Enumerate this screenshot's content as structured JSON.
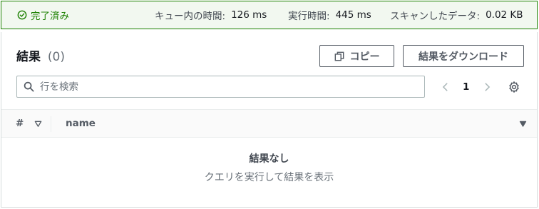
{
  "status": {
    "state_label": "完了済み",
    "queue_time_label": "キュー内の時間:",
    "queue_time_value": "126 ms",
    "run_time_label": "実行時間:",
    "run_time_value": "445 ms",
    "data_scanned_label": "スキャンしたデータ:",
    "data_scanned_value": "0.02 KB"
  },
  "results": {
    "title": "結果",
    "count": "(0)",
    "copy_label": "コピー",
    "download_label": "結果をダウンロード",
    "search_placeholder": "行を検索",
    "page_number": "1"
  },
  "table": {
    "columns": [
      "#",
      "name"
    ]
  },
  "empty": {
    "title": "結果なし",
    "subtitle": "クエリを実行して結果を表示"
  },
  "colors": {
    "success": "#1d8102",
    "border": "#d5dbdb",
    "text": "#16191f"
  }
}
